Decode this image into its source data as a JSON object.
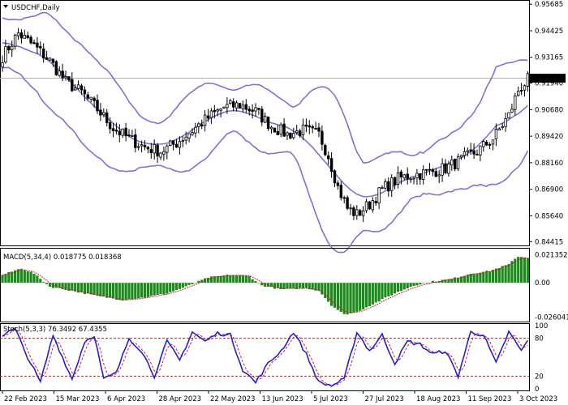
{
  "window": {
    "title": "USDCHF,Daily",
    "menu_icon": "triangle-down-icon"
  },
  "colors": {
    "candle": "#000000",
    "bollinger": "#7a76d0",
    "macd_hist": "#1a8a1a",
    "macd_signal": "#d02040",
    "stoch_main": "#2222cc",
    "stoch_signal": "#d02040",
    "level_line": "#c02020",
    "price_marker_bg": "#000000",
    "price_marker_fg": "#ffffff"
  },
  "chart_data": [
    {
      "type": "candlestick",
      "title": "USDCHF,Daily",
      "y_ticks": [
        "0.95685",
        "0.94425",
        "0.93165",
        "0.91940",
        "0.90680",
        "0.89420",
        "0.88160",
        "0.86900",
        "0.85640",
        "0.84415"
      ],
      "ylim": [
        0.8435,
        0.9573
      ],
      "current_price": "0.92172",
      "x_ticks": [
        "22 Feb 2023",
        "15 Mar 2023",
        "6 Apr 2023",
        "28 Apr 2023",
        "22 May 2023",
        "13 Jun 2023",
        "5 Jul 2023",
        "27 Jul 2023",
        "18 Aug 2023",
        "11 Sep 2023",
        "3 Oct 2023"
      ],
      "close_profile": [
        [
          0,
          0.932
        ],
        [
          5,
          0.943
        ],
        [
          10,
          0.937
        ],
        [
          15,
          0.93
        ],
        [
          20,
          0.92
        ],
        [
          25,
          0.915
        ],
        [
          30,
          0.907
        ],
        [
          35,
          0.898
        ],
        [
          40,
          0.893
        ],
        [
          45,
          0.889
        ],
        [
          50,
          0.887
        ],
        [
          55,
          0.891
        ],
        [
          60,
          0.897
        ],
        [
          65,
          0.903
        ],
        [
          70,
          0.908
        ],
        [
          75,
          0.909
        ],
        [
          80,
          0.906
        ],
        [
          85,
          0.899
        ],
        [
          90,
          0.895
        ],
        [
          95,
          0.897
        ],
        [
          100,
          0.895
        ],
        [
          103,
          0.885
        ],
        [
          106,
          0.87
        ],
        [
          109,
          0.86
        ],
        [
          112,
          0.857
        ],
        [
          116,
          0.862
        ],
        [
          120,
          0.869
        ],
        [
          125,
          0.874
        ],
        [
          130,
          0.876
        ],
        [
          135,
          0.877
        ],
        [
          140,
          0.879
        ],
        [
          145,
          0.883
        ],
        [
          150,
          0.887
        ],
        [
          155,
          0.893
        ],
        [
          160,
          0.904
        ],
        [
          163,
          0.916
        ],
        [
          166,
          0.921
        ]
      ],
      "bollinger_period": 20
    },
    {
      "type": "bar",
      "title": "MACD(5,34,4) 0.018775 0.018368",
      "y_ticks": [
        "0.021352",
        "0.00",
        "-0.026041"
      ],
      "ylim": [
        -0.0275,
        0.024
      ],
      "profile": [
        [
          0,
          0.006
        ],
        [
          6,
          0.011
        ],
        [
          10,
          0.007
        ],
        [
          15,
          -0.003
        ],
        [
          22,
          -0.006
        ],
        [
          30,
          -0.01
        ],
        [
          38,
          -0.013
        ],
        [
          45,
          -0.011
        ],
        [
          52,
          -0.008
        ],
        [
          58,
          -0.003
        ],
        [
          65,
          0.004
        ],
        [
          72,
          0.006
        ],
        [
          78,
          0.005
        ],
        [
          82,
          -0.002
        ],
        [
          88,
          -0.005
        ],
        [
          96,
          -0.004
        ],
        [
          100,
          -0.006
        ],
        [
          104,
          -0.017
        ],
        [
          108,
          -0.024
        ],
        [
          112,
          -0.022
        ],
        [
          118,
          -0.015
        ],
        [
          124,
          -0.008
        ],
        [
          130,
          -0.002
        ],
        [
          136,
          0.001
        ],
        [
          142,
          0.003
        ],
        [
          148,
          0.007
        ],
        [
          154,
          0.009
        ],
        [
          160,
          0.014
        ],
        [
          163,
          0.02
        ],
        [
          166,
          0.019
        ]
      ]
    },
    {
      "type": "line",
      "title": "Stoch(5,3,3) 76.3492 67.4355",
      "y_ticks": [
        "100",
        "80",
        "20",
        "0"
      ],
      "ylim": [
        0,
        100
      ],
      "levels": [
        80,
        20
      ],
      "profile": [
        [
          0,
          85
        ],
        [
          4,
          95
        ],
        [
          7,
          60
        ],
        [
          12,
          10
        ],
        [
          16,
          85
        ],
        [
          19,
          50
        ],
        [
          22,
          15
        ],
        [
          26,
          75
        ],
        [
          29,
          85
        ],
        [
          32,
          15
        ],
        [
          36,
          25
        ],
        [
          40,
          80
        ],
        [
          44,
          60
        ],
        [
          48,
          20
        ],
        [
          52,
          75
        ],
        [
          56,
          45
        ],
        [
          60,
          90
        ],
        [
          64,
          75
        ],
        [
          68,
          88
        ],
        [
          72,
          85
        ],
        [
          76,
          30
        ],
        [
          80,
          10
        ],
        [
          84,
          40
        ],
        [
          88,
          60
        ],
        [
          92,
          90
        ],
        [
          96,
          55
        ],
        [
          100,
          10
        ],
        [
          104,
          5
        ],
        [
          108,
          15
        ],
        [
          112,
          90
        ],
        [
          116,
          60
        ],
        [
          120,
          85
        ],
        [
          124,
          40
        ],
        [
          128,
          75
        ],
        [
          132,
          70
        ],
        [
          136,
          55
        ],
        [
          140,
          60
        ],
        [
          144,
          20
        ],
        [
          148,
          90
        ],
        [
          152,
          85
        ],
        [
          156,
          40
        ],
        [
          160,
          90
        ],
        [
          164,
          60
        ],
        [
          166,
          76
        ]
      ]
    }
  ]
}
